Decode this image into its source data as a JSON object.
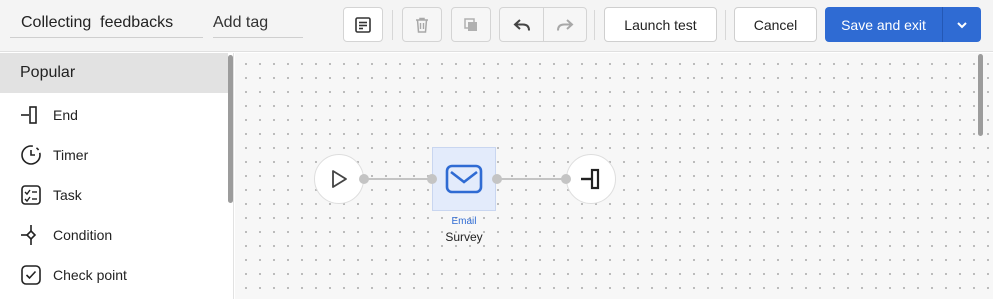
{
  "header": {
    "title_value": "Collecting  feedbacks",
    "tag_placeholder": "Add tag",
    "launch_label": "Launch test",
    "cancel_label": "Cancel",
    "save_label": "Save and exit"
  },
  "sidebar": {
    "section_title": "Popular",
    "items": [
      {
        "label": "End",
        "icon": "end-icon"
      },
      {
        "label": "Timer",
        "icon": "timer-icon"
      },
      {
        "label": "Task",
        "icon": "task-icon"
      },
      {
        "label": "Condition",
        "icon": "condition-icon"
      },
      {
        "label": "Check point",
        "icon": "checkpoint-icon"
      }
    ]
  },
  "flow": {
    "email_node": {
      "type_label": "Email",
      "title": "Survey"
    }
  },
  "colors": {
    "primary": "#2f6bd3",
    "node_bg": "#e3ebfb"
  }
}
